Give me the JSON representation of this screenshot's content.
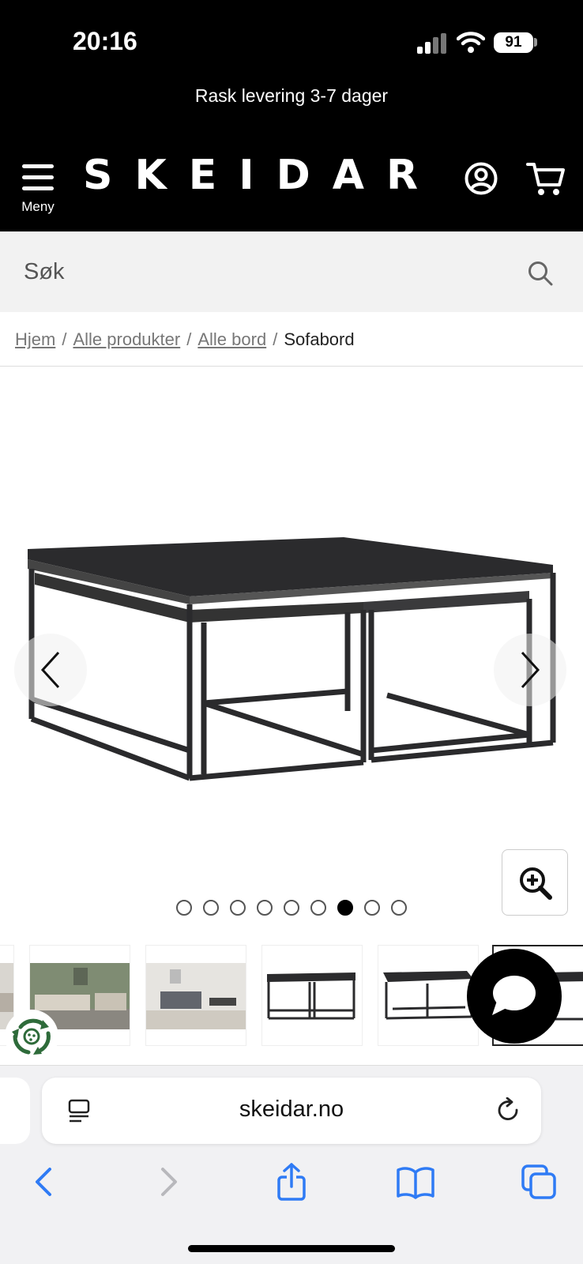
{
  "status_bar": {
    "time": "20:16",
    "battery": "91"
  },
  "promo": {
    "text": "Rask levering 3-7 dager"
  },
  "header": {
    "menu_label": "Meny",
    "logo": "SKEIDAR"
  },
  "search": {
    "placeholder": "Søk"
  },
  "breadcrumb": {
    "items": [
      "Hjem",
      "Alle produkter",
      "Alle bord"
    ],
    "separator": "/",
    "current": "Sofabord"
  },
  "gallery": {
    "dot_count": 9,
    "active_index": 6
  },
  "browser": {
    "url": "skeidar.no"
  },
  "colors": {
    "header_bg": "#000000",
    "search_bg": "#f2f2f2",
    "ios_blue": "#2f7bf5",
    "eco_green": "#2e6b3a"
  }
}
